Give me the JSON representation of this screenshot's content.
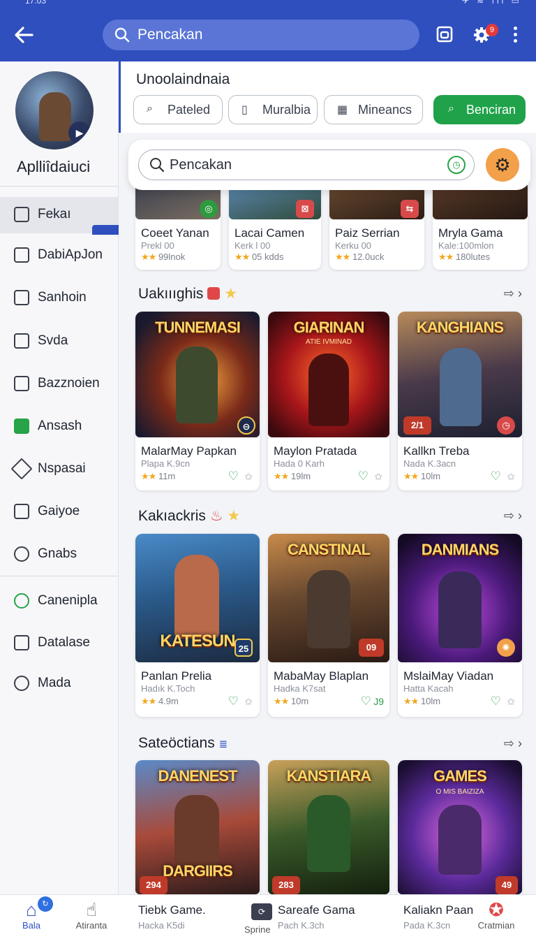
{
  "status": {
    "time": "17:03",
    "indicators": "✈ ≋ ıll ▭"
  },
  "header": {
    "search_placeholder": "Pencakan",
    "notif_count": "9"
  },
  "sidebar": {
    "app_name": "Aplliîdaiuci",
    "items": [
      {
        "label": "Fekaı",
        "icon": "fix-icon"
      },
      {
        "label": "DabiApJon",
        "icon": "briefcase-icon"
      },
      {
        "label": "Sanhoin",
        "icon": "square-icon"
      },
      {
        "label": "Svda",
        "icon": "grid-icon"
      },
      {
        "label": "Bazznoien",
        "icon": "grid-icon"
      },
      {
        "label": "Ansash",
        "icon": "book-icon"
      },
      {
        "label": "Nspasai",
        "icon": "tag-icon"
      },
      {
        "label": "Gaiyoe",
        "icon": "grid-icon"
      },
      {
        "label": "Gnabs",
        "icon": "heart-icon"
      },
      {
        "label": "Canenipla",
        "icon": "whatsapp-icon"
      },
      {
        "label": "Datalase",
        "icon": "briefcase-icon"
      },
      {
        "label": "Mada",
        "icon": "heart-icon"
      }
    ]
  },
  "filters": {
    "title": "Unoolaindnaia",
    "chips": [
      "Pateled",
      "Muralbia",
      "Mineancs"
    ],
    "action": "Benciran"
  },
  "search": {
    "placeholder": "Pencakan"
  },
  "top_row": [
    {
      "name": "Coeet Yanan",
      "sub": "Prekl 00",
      "rating": "99lnok"
    },
    {
      "name": "Lacai Camen",
      "sub": "Kerk l 00",
      "rating": "05 kdds"
    },
    {
      "name": "Paiz Serrian",
      "sub": "Kerku 00",
      "rating": "12.0uck"
    },
    {
      "name": "Mryla Gama",
      "sub": "Kale:100mlon",
      "rating": "180lutes"
    }
  ],
  "sections": [
    {
      "title": "Uakıııghis",
      "more": "›",
      "cards": [
        {
          "art": "TUNNEMASI",
          "name": "MalarMay Papkan",
          "sub": "Plapa K.9cn",
          "rating": "11m",
          "badge": "⊖"
        },
        {
          "art": "GIARINAN",
          "art_sub": "ATIE IVMINAD",
          "name": "Maylon Pratada",
          "sub": "Hada 0 Karh",
          "rating": "19lm",
          "badge": ""
        },
        {
          "art": "KANGHIANS",
          "name": "Kallkn Treba",
          "sub": "Nada K.3acn",
          "rating": "10lm",
          "badge": "2/1"
        }
      ]
    },
    {
      "title": "Kakıackris",
      "more": "›",
      "cards": [
        {
          "art": "KATESUN",
          "name": "Panlan Prelia",
          "sub": "Hadık K.Toch",
          "rating": "4.9m",
          "badge": "25"
        },
        {
          "art": "CANSTINAL",
          "name": "MabaMay Blaplan",
          "sub": "Hadka K7sat",
          "rating": "10m",
          "badge": "09",
          "extra": "J9"
        },
        {
          "art": "DANMIANS",
          "name": "MslaiMay Viadan",
          "sub": "Hatta Kacah",
          "rating": "10lm",
          "badge": "✺"
        }
      ]
    },
    {
      "title": "Sateöctians",
      "more": "›",
      "cards": [
        {
          "art": "DANENEST",
          "art2": "DARGIIRS",
          "badge": "294"
        },
        {
          "art": "KANSTIARA",
          "badge": "283"
        },
        {
          "art": "GAMES",
          "art_sub": "O MIS BAIZIZA",
          "badge": "49"
        }
      ]
    }
  ],
  "bottom_nav": [
    {
      "label": "Bala",
      "icon": "home-icon",
      "badge": "↻"
    },
    {
      "label": "Atiranta",
      "icon": "gesture-icon"
    }
  ],
  "bottom_peek": [
    {
      "title": "Tiebk Game.",
      "sub": "Hacka K5di"
    },
    {
      "title": "Sareafe Gama",
      "sub": "Pach K.3ch",
      "small": "Sprine"
    },
    {
      "title": "Kaliakn Paan",
      "sub": "Pada K.3cn"
    },
    {
      "title": "Cratmian",
      "sub": ""
    }
  ],
  "colors": {
    "appbar": "#2f4fbf",
    "accent_green": "#1fa24a",
    "star": "#f0a81e",
    "gear_bg": "#f2a04a"
  }
}
